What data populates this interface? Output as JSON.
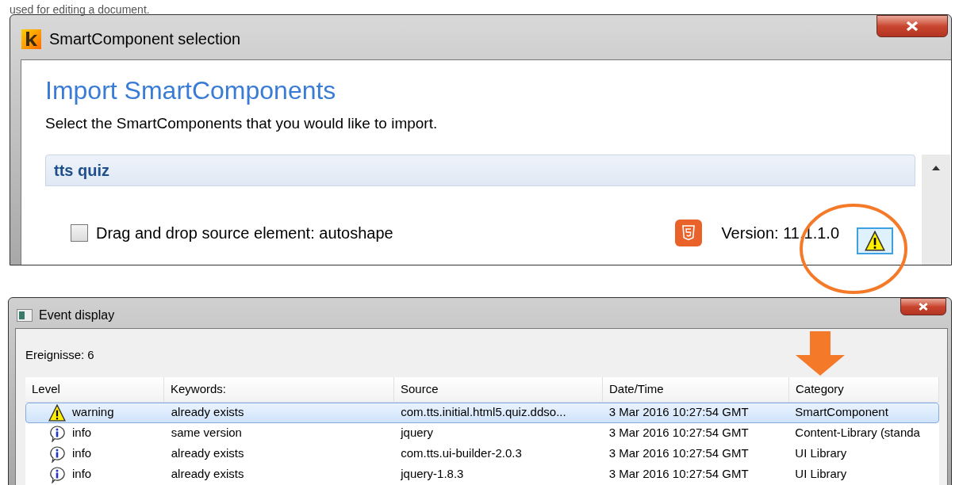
{
  "doc_text": "used for editing a document.",
  "selection_dialog": {
    "title": "SmartComponent selection",
    "heading": "Import SmartComponents",
    "instruction": "Select the SmartComponents that you would like to import.",
    "section": {
      "title": "tts quiz",
      "items": [
        {
          "label": "Drag and drop source element: autoshape",
          "checked": false,
          "version": "Version: 11.1.1.0"
        }
      ]
    }
  },
  "event_dialog": {
    "title": "Event display",
    "count": "Ereignisse: 6",
    "table": {
      "columns": [
        "Level",
        "Keywords:",
        "Source",
        "Date/Time",
        "Category"
      ],
      "rows": [
        {
          "kind": "warning",
          "selected": true,
          "cells": [
            "warning",
            "already exists",
            "com.tts.initial.html5.quiz.ddso...",
            "3 Mar 2016 10:27:54 GMT",
            "SmartComponent"
          ]
        },
        {
          "kind": "info",
          "selected": false,
          "cells": [
            "info",
            "same version",
            "jquery",
            "3 Mar 2016 10:27:54 GMT",
            "Content-Library (standa"
          ]
        },
        {
          "kind": "info",
          "selected": false,
          "cells": [
            "info",
            "already exists",
            "com.tts.ui-builder-2.0.3",
            "3 Mar 2016 10:27:54 GMT",
            "UI Library"
          ]
        },
        {
          "kind": "info",
          "selected": false,
          "cells": [
            "info",
            "already exists",
            "jquery-1.8.3",
            "3 Mar 2016 10:27:54 GMT",
            "UI Library"
          ]
        }
      ]
    }
  }
}
